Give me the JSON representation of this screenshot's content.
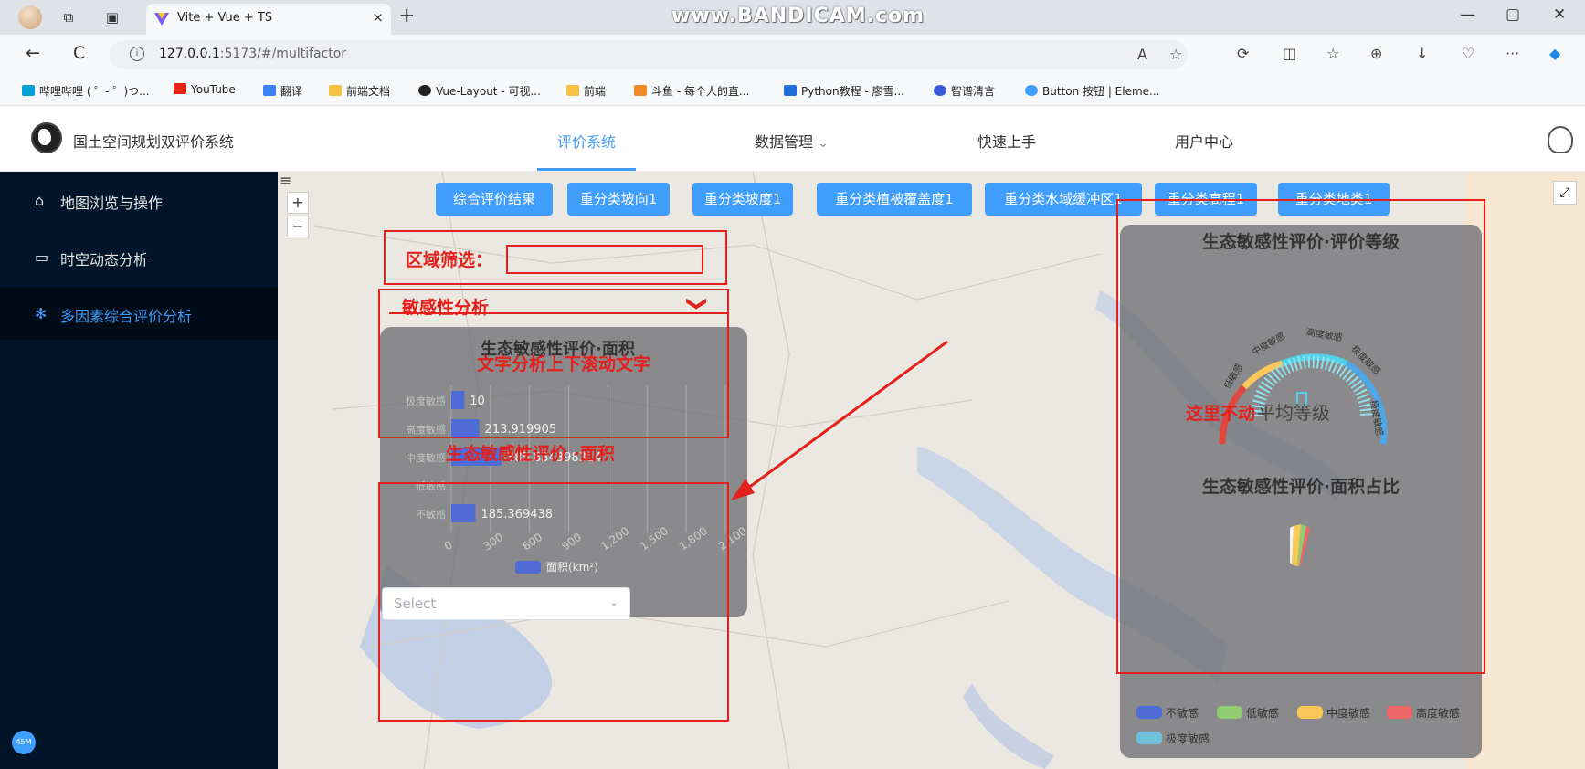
{
  "browser": {
    "tab_title": "Vite + Vue + TS",
    "watermark": "www.BANDICAM.com",
    "url_host": "127.0.0.1",
    "url_path": ":5173/#/multifactor",
    "close_tab_glyph": "×",
    "new_tab_glyph": "+",
    "minimize_glyph": "—",
    "maximize_glyph": "▢",
    "close_window_glyph": "✕",
    "back_glyph": "←",
    "reload_glyph": "C",
    "more_glyph": "···"
  },
  "bookmarks": [
    {
      "label": "哔哩哔哩 ( ゜- ゜)つ...",
      "color": "#00a1d6"
    },
    {
      "label": "YouTube",
      "color": "#e62117"
    },
    {
      "label": "翻译",
      "color": "#3b82f6"
    },
    {
      "label": "前端文档",
      "color": "#f5c242"
    },
    {
      "label": "Vue-Layout - 可视...",
      "color": "#222222"
    },
    {
      "label": "前端",
      "color": "#f5c242"
    },
    {
      "label": "斗鱼 - 每个人的直...",
      "color": "#f08a24"
    },
    {
      "label": "Python教程 - 廖雪...",
      "color": "#1e6fd9"
    },
    {
      "label": "智谱清言",
      "color": "#3a5bd9"
    },
    {
      "label": "Button 按钮 | Eleme...",
      "color": "#409eff"
    }
  ],
  "app": {
    "title": "国土空间规划双评价系统",
    "nav": [
      {
        "label": "评价系统",
        "active": true
      },
      {
        "label": "数据管理",
        "dropdown": true
      },
      {
        "label": "快速上手"
      },
      {
        "label": "用户中心"
      }
    ],
    "dropdown_glyph": "⌄"
  },
  "sidebar": {
    "items": [
      {
        "label": "地图浏览与操作",
        "icon": "home-icon",
        "glyph": "⌂"
      },
      {
        "label": "时空动态分析",
        "icon": "monitor-icon",
        "glyph": "▭"
      },
      {
        "label": "多因素综合评价分析",
        "icon": "gear-icon",
        "glyph": "✻",
        "active": true
      }
    ],
    "badge": "45M"
  },
  "map": {
    "zoom_in": "+",
    "zoom_out": "−",
    "menu_glyph": "≡",
    "fullscreen_glyph": "⤢",
    "layer_buttons": [
      "综合评价结果",
      "重分类坡向1",
      "重分类坡度1",
      "重分类植被覆盖度1",
      "重分类水域缓冲区1",
      "重分类高程1",
      "重分类地类1"
    ]
  },
  "annotations": {
    "region_filter_label": "区域筛选：",
    "sensitivity_analysis": "敏感性分析",
    "scroll_text": "文字分析上下滚动文字",
    "area_title": "生态敏感性评价 ·面积",
    "fixed_here": "这里不动",
    "collapse_glyph": "❯"
  },
  "area_panel": {
    "title": "生态敏感性评价·面积",
    "select_placeholder": "Select",
    "select_arrow": "⌄"
  },
  "chart_data": [
    {
      "type": "bar",
      "orientation": "horizontal",
      "title": "生态敏感性评价·面积",
      "categories": [
        "极度敏感",
        "高度敏感",
        "中度敏感",
        "低敏感",
        "不敏感"
      ],
      "series": [
        {
          "name": "面积(km²)",
          "values": [
            100,
            213.919905,
            385.834398314,
            null,
            185.369438
          ]
        }
      ],
      "value_labels": [
        "10",
        "213.919905",
        "385.834398314",
        "",
        "185.369438"
      ],
      "x_ticks": [
        "0",
        "300",
        "600",
        "900",
        "1,200",
        "1,500",
        "1,800",
        "2,100"
      ],
      "xlim": [
        0,
        2100
      ],
      "grid": true,
      "legend": "bottom"
    },
    {
      "type": "gauge",
      "title": "生态敏感性评价·评价等级",
      "center_label": "平均等级",
      "value": "0",
      "segment_labels": [
        "低敏感",
        "中度敏感",
        "高度敏感",
        "极度敏感",
        "极度敏感"
      ]
    },
    {
      "type": "pie",
      "title": "生态敏感性评价·面积占比",
      "legend": [
        {
          "label": "不敏感",
          "color": "#4f6bd6"
        },
        {
          "label": "低敏感",
          "color": "#91cc75"
        },
        {
          "label": "中度敏感",
          "color": "#fac858"
        },
        {
          "label": "高度敏感",
          "color": "#ee6666"
        },
        {
          "label": "极度敏感",
          "color": "#73c0de"
        }
      ]
    }
  ],
  "colors": {
    "accent": "#409eff",
    "sidebar_bg": "#001529",
    "annotation_red": "#e3201c"
  }
}
